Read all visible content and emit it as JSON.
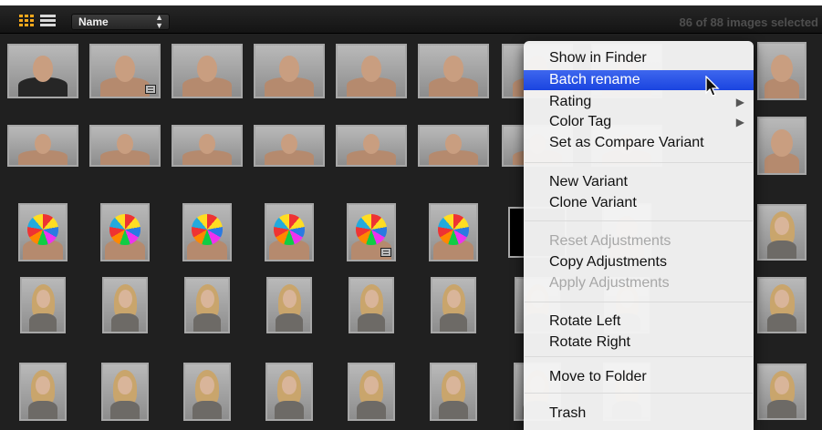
{
  "toolbar": {
    "sort_label": "Name",
    "sort_arrows": "▲\n▼",
    "status": "86 of 88 images selected",
    "grid_icon": "grid-view-icon",
    "list_icon": "list-view-icon"
  },
  "context_menu": {
    "items": [
      {
        "label": "Show in Finder",
        "state": "enabled"
      },
      {
        "label": "Batch rename",
        "state": "highlighted"
      },
      {
        "label": "Rating",
        "state": "enabled",
        "submenu": true
      },
      {
        "label": "Color Tag",
        "state": "enabled",
        "submenu": true
      },
      {
        "label": "Set as Compare Variant",
        "state": "enabled"
      },
      {
        "label": "New Variant",
        "state": "enabled"
      },
      {
        "label": "Clone Variant",
        "state": "enabled"
      },
      {
        "label": "Reset Adjustments",
        "state": "disabled"
      },
      {
        "label": "Copy Adjustments",
        "state": "enabled"
      },
      {
        "label": "Apply Adjustments",
        "state": "disabled"
      },
      {
        "label": "Rotate Left",
        "state": "enabled"
      },
      {
        "label": "Rotate Right",
        "state": "enabled"
      },
      {
        "label": "Move to Folder",
        "state": "enabled"
      },
      {
        "label": "Trash",
        "state": "enabled"
      }
    ],
    "submenu_glyph": "▶"
  },
  "colors": {
    "highlight": "#2a55e8",
    "grid_icon_active": "#f6a81c",
    "background": "#202020"
  }
}
